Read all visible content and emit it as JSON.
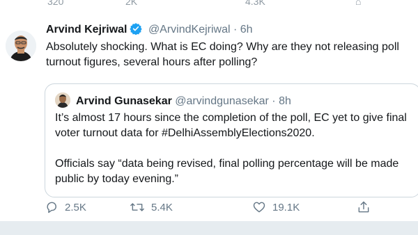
{
  "previous_tweet_counts": {
    "replies": "320",
    "retweets": "2K",
    "likes": "4.3K"
  },
  "tweet": {
    "name": "Arvind Kejriwal",
    "handle": "@ArvindKejriwal",
    "separator": "·",
    "time": "6h",
    "text_line1": "Absolutely shocking. What is EC doing? Why are they not releasing poll",
    "text_line2": "turnout figures, several hours after polling?",
    "quoted": {
      "name": "Arvind Gunasekar",
      "handle": "@arvindgunasekar",
      "separator": "·",
      "time": "8h",
      "line1": "It’s almost 17 hours since the completion of the poll, EC yet to give final",
      "line2": "voter turnout data for #DelhiAssemblyElections2020.",
      "line3": "Officials say “data being revised, final polling percentage will be made",
      "line4": "public by today evening.”"
    },
    "actions": {
      "replies": "2.5K",
      "retweets": "5.4K",
      "likes": "19.1K"
    }
  },
  "colors": {
    "text": "#14171a",
    "secondary": "#657786",
    "verified": "#1da1f2",
    "border": "#ccd6dd",
    "footer_bg": "#e6ecf0"
  },
  "icons": {
    "verified": "verified-badge-icon",
    "reply": "reply-icon",
    "retweet": "retweet-icon",
    "like": "heart-icon",
    "share": "share-icon"
  }
}
